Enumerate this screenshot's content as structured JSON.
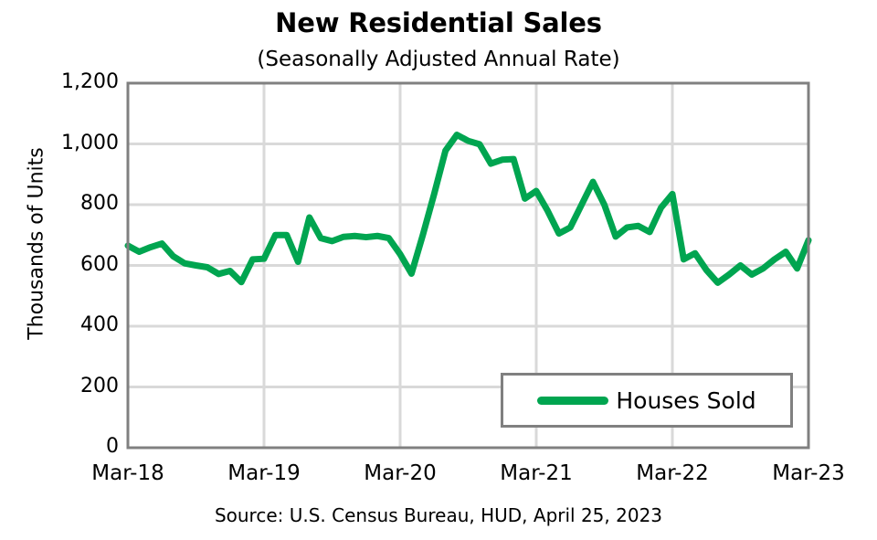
{
  "chart_data": {
    "type": "line",
    "title": "New Residential Sales",
    "subtitle": "(Seasonally Adjusted Annual Rate)",
    "source": "Source:  U.S. Census Bureau, HUD, April 25, 2023",
    "xlabel": "",
    "ylabel": "Thousands of Units",
    "ylim": [
      0,
      1200
    ],
    "ytick_values": [
      1200,
      1000,
      800,
      600,
      400,
      200,
      0
    ],
    "ytick_labels": [
      "1,200",
      "1,000",
      "800",
      "600",
      "400",
      "200",
      "0"
    ],
    "xtick_labels": [
      "Mar-18",
      "Mar-19",
      "Mar-20",
      "Mar-21",
      "Mar-22",
      "Mar-23"
    ],
    "xtick_values": [
      0,
      12,
      24,
      36,
      48,
      60
    ],
    "xlim": [
      0,
      60
    ],
    "grid": true,
    "legend": {
      "position": "inside-bottom-right",
      "entries": [
        {
          "name": "Houses Sold",
          "color": "#00A550"
        }
      ]
    },
    "series": [
      {
        "name": "Houses Sold",
        "color": "#00A550",
        "line_width": 7,
        "x": [
          0,
          1,
          2,
          3,
          4,
          5,
          6,
          7,
          8,
          9,
          10,
          11,
          12,
          13,
          14,
          15,
          16,
          17,
          18,
          19,
          20,
          21,
          22,
          23,
          24,
          25,
          26,
          27,
          28,
          29,
          30,
          31,
          32,
          33,
          34,
          35,
          36,
          37,
          38,
          39,
          40,
          41,
          42,
          43,
          44,
          45,
          46,
          47,
          48,
          49,
          50,
          51,
          52,
          53,
          54,
          55,
          56,
          57,
          58,
          59,
          60
        ],
        "x_labels": [
          "Mar-18",
          "Apr-18",
          "May-18",
          "Jun-18",
          "Jul-18",
          "Aug-18",
          "Sep-18",
          "Oct-18",
          "Nov-18",
          "Dec-18",
          "Jan-19",
          "Feb-19",
          "Mar-19",
          "Apr-19",
          "May-19",
          "Jun-19",
          "Jul-19",
          "Aug-19",
          "Sep-19",
          "Oct-19",
          "Nov-19",
          "Dec-19",
          "Jan-20",
          "Feb-20",
          "Mar-20",
          "Apr-20",
          "May-20",
          "Jun-20",
          "Jul-20",
          "Aug-20",
          "Sep-20",
          "Oct-20",
          "Nov-20",
          "Dec-20",
          "Jan-21",
          "Feb-21",
          "Mar-21",
          "Apr-21",
          "May-21",
          "Jun-21",
          "Jul-21",
          "Aug-21",
          "Sep-21",
          "Oct-21",
          "Nov-21",
          "Dec-21",
          "Jan-22",
          "Feb-22",
          "Mar-22",
          "Apr-22",
          "May-22",
          "Jun-22",
          "Jul-22",
          "Aug-22",
          "Sep-22",
          "Oct-22",
          "Nov-22",
          "Dec-22",
          "Jan-23",
          "Feb-23",
          "Mar-23"
        ],
        "values": [
          665,
          645,
          660,
          672,
          630,
          607,
          600,
          594,
          572,
          582,
          545,
          620,
          622,
          700,
          700,
          612,
          758,
          690,
          680,
          694,
          697,
          693,
          697,
          690,
          637,
          573,
          700,
          835,
          978,
          1030,
          1010,
          999,
          935,
          948,
          950,
          820,
          845,
          780,
          705,
          725,
          800,
          875,
          800,
          695,
          725,
          730,
          710,
          790,
          835,
          620,
          640,
          585,
          543,
          570,
          600,
          570,
          590,
          620,
          645,
          590,
          683
        ]
      }
    ]
  }
}
